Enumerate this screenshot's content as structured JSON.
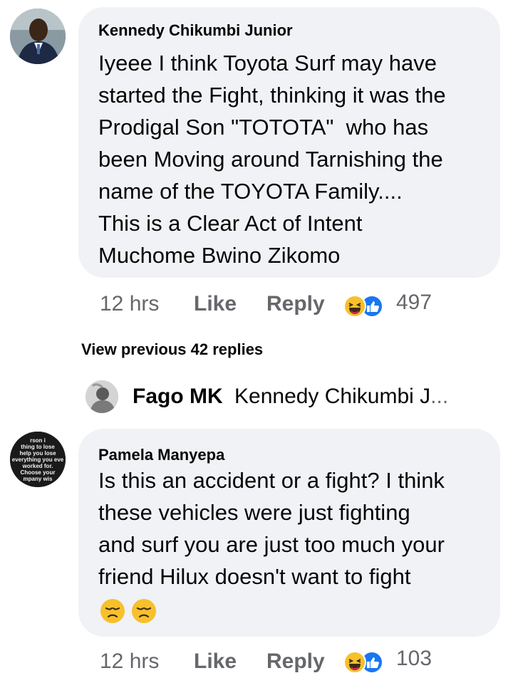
{
  "comments": [
    {
      "author": "Kennedy Chikumbi Junior",
      "lines": [
        "Iyeee I think Toyota Surf may have",
        "started the Fight, thinking it was the",
        "Prodigal Son \"TOTOTA\"  who has",
        "been Moving around Tarnishing the",
        "name of the TOYOTA Family....",
        "This is a Clear Act of Intent",
        "Muchome Bwino Zikomo"
      ],
      "time": "12 hrs",
      "like_label": "Like",
      "reply_label": "Reply",
      "reaction_count": "497",
      "reaction_icons": [
        "laughing-face-icon",
        "thumbs-up-icon"
      ]
    },
    {
      "author": "Pamela Manyepa",
      "lines": [
        "Is this an accident or a fight? I think",
        "these vehicles were just fighting",
        "and surf you are just too much your",
        "friend Hilux doesn't want to fight"
      ],
      "emojis": [
        "disappointed-face-icon",
        "disappointed-face-icon"
      ],
      "time": "12 hrs",
      "like_label": "Like",
      "reply_label": "Reply",
      "reaction_count": "103",
      "reaction_icons": [
        "laughing-face-icon",
        "thumbs-up-icon"
      ]
    }
  ],
  "view_previous": "View previous 42 replies",
  "reply_preview": {
    "author": "Fago MK",
    "text": "Kennedy Chikumbi J",
    "ellipsis": "..."
  },
  "avatar2_text": [
    "rson i",
    "thing to lose",
    "help you lose",
    "everything you eve",
    "worked for.",
    "Choose your",
    "mpany wis"
  ],
  "colors": {
    "bubble": "#f0f2f5",
    "meta": "#65676b",
    "like_blue": "#1877f2",
    "haha_yellow": "#f7c02c"
  }
}
